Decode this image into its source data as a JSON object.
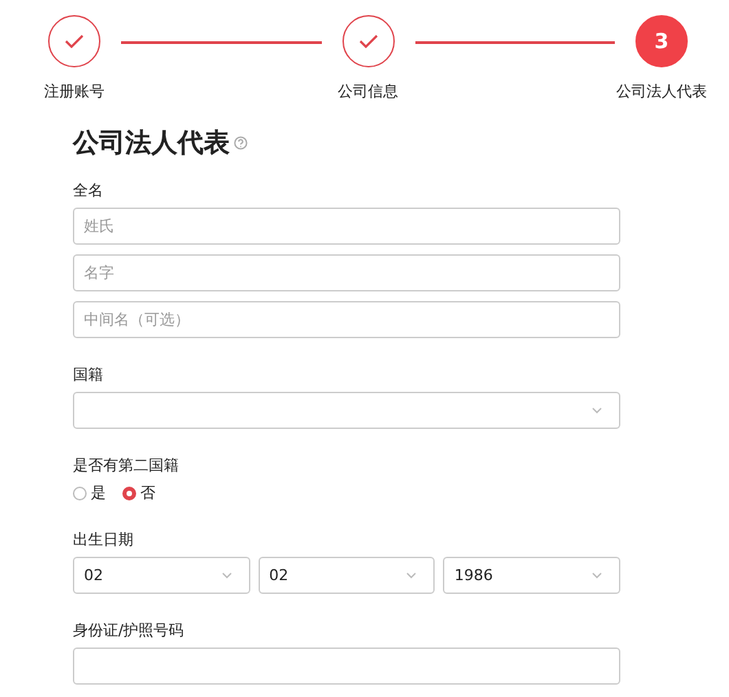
{
  "steps": [
    {
      "label": "注册账号",
      "done": true,
      "selected": false
    },
    {
      "label": "公司信息",
      "done": true,
      "selected": false
    },
    {
      "label": "公司法人代表",
      "number": "3",
      "done": false,
      "selected": true
    }
  ],
  "heading": "公司法人代表",
  "full_name": {
    "label": "全名",
    "fields": [
      {
        "placeholder": "姓氏"
      },
      {
        "placeholder": "名字"
      },
      {
        "placeholder": "中间名（可选）"
      }
    ]
  },
  "nationality": {
    "label": "国籍"
  },
  "second_nationality": {
    "label": "是否有第二国籍",
    "options": [
      {
        "label": "是",
        "selected": false
      },
      {
        "label": "否",
        "selected": true
      }
    ]
  },
  "birth_date": {
    "label": "出生日期",
    "selects": [
      {
        "value": "02"
      },
      {
        "value": "02"
      },
      {
        "value": "1986"
      }
    ]
  },
  "id_number": {
    "label": "身份证/护照号码"
  }
}
